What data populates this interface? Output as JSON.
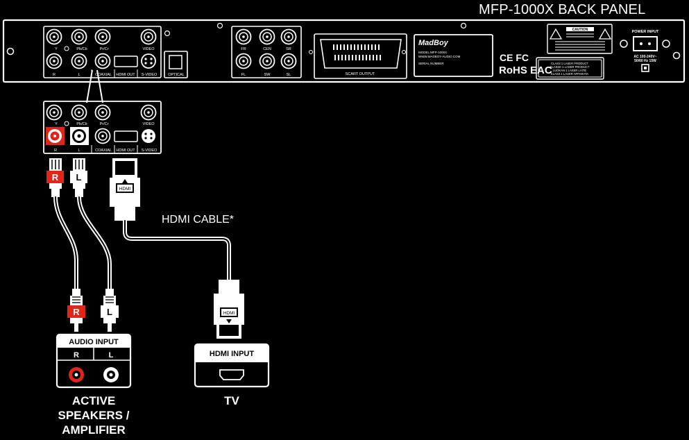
{
  "panel": {
    "title": "MFP-1000X BACK PANEL",
    "video_out": {
      "y": "Y",
      "pb": "Pb/Cb",
      "pr": "Pr/Cr",
      "video": "VIDEO",
      "r": "R",
      "l": "L",
      "coaxial": "COAXIAL",
      "hdmi_out": "HDMI OUT",
      "svideo": "S-VIDEO"
    },
    "optical": "OPTICAL",
    "surround": {
      "fr": "FR",
      "cen": "CEN",
      "sr": "SR",
      "fl": "FL",
      "sw": "SW",
      "sl": "SL"
    },
    "scart": "SCART OUTPUT",
    "label_plate": {
      "brand": "MadBoy",
      "model": "MODEL MFP-1000X",
      "website": "WWW.MADBOY-AUDIO.COM",
      "serial": "SERIAL NUMBER"
    },
    "cert": {
      "ce_fc": "CE FC",
      "rohs": "RoHS EAC"
    },
    "caution_title": "CAUTION",
    "laser": [
      "CLASS 1 LASER PRODUCT",
      "KLASSE 1 LASER PRODUCT",
      "LUOKAN 1 LASER LAITE",
      "KLASS 1 LASER APPARATA"
    ],
    "power": {
      "title": "POWER INPUT",
      "spec1": "AC 100-240V~",
      "spec2": "50/60 Hz 15W"
    }
  },
  "connectors": {
    "rca_right": "R",
    "rca_left": "L",
    "hdmi": "HDMI"
  },
  "hdmi_cable_label": "HDMI CABLE*",
  "speakers": {
    "box_title": "AUDIO INPUT",
    "r": "R",
    "l": "L",
    "label_line1": "ACTIVE",
    "label_line2": "SPEAKERS /",
    "label_line3": "AMPLIFIER"
  },
  "tv": {
    "box_title": "HDMI INPUT",
    "label": "TV"
  },
  "colors": {
    "background": "#000000",
    "stroke": "#ffffff",
    "right_channel": "#e0251b"
  }
}
